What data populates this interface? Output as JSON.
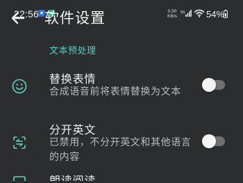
{
  "status_bar": {
    "time": "22:56",
    "net_speed_value": "0.50",
    "net_speed_unit": "KB/s",
    "battery": "54%"
  },
  "header": {
    "title": "软件设置"
  },
  "section": {
    "header": "文本预处理"
  },
  "settings": [
    {
      "title": "替换表情",
      "description": "合成语音前将表情替换为文本",
      "enabled": false,
      "icon": "smiley-icon"
    },
    {
      "title": "分开英文",
      "description": "已禁用，不分开英文和其他语言的内容",
      "enabled": false,
      "icon": "split-text-icon"
    }
  ],
  "next_row_partial_title": "朗读阅读"
}
